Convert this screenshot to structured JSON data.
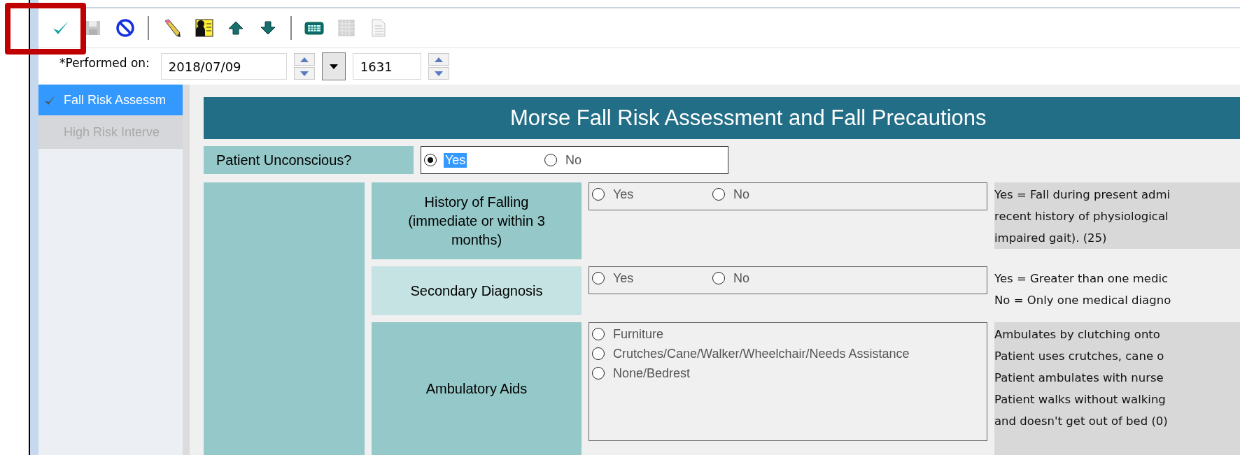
{
  "toolbar": [
    {
      "kind": "check",
      "disabled": false
    },
    {
      "kind": "save",
      "disabled": true
    },
    {
      "kind": "cancel",
      "disabled": false
    },
    {
      "kind": "separator"
    },
    {
      "kind": "pen",
      "disabled": false
    },
    {
      "kind": "card",
      "disabled": false
    },
    {
      "kind": "up",
      "disabled": false
    },
    {
      "kind": "down",
      "disabled": false
    },
    {
      "kind": "separator"
    },
    {
      "kind": "calculator",
      "disabled": false
    },
    {
      "kind": "grid",
      "disabled": true
    },
    {
      "kind": "document",
      "disabled": true
    }
  ],
  "performed": {
    "label": "*Performed on:",
    "date": "2018/07/09",
    "time": "1631"
  },
  "sidebar": {
    "items": [
      {
        "label": "Fall Risk Assessm",
        "selected": true,
        "checked": true
      },
      {
        "label": "High Risk Interve",
        "selected": false,
        "checked": false
      }
    ]
  },
  "form": {
    "title": "Morse Fall Risk Assessment and Fall Precautions",
    "unconscious": {
      "label": "Patient Unconscious?",
      "options": [
        {
          "label": "Yes",
          "selected": true
        },
        {
          "label": "No",
          "selected": false
        }
      ]
    },
    "rows": [
      {
        "label": "History of Falling (immediate or within 3 months)",
        "kind": "inline",
        "pale": false,
        "options": [
          {
            "label": "Yes",
            "selected": false
          },
          {
            "label": "No",
            "selected": false
          }
        ],
        "shaded": true,
        "description": [
          "Yes = Fall during present admi",
          "recent history of physiological",
          "impaired gait). (25)"
        ]
      },
      {
        "label": "Secondary Diagnosis",
        "kind": "inline",
        "pale": true,
        "options": [
          {
            "label": "Yes",
            "selected": false
          },
          {
            "label": "No",
            "selected": false
          }
        ],
        "shaded": false,
        "description": [
          "Yes = Greater than one medic",
          "No  = Only one medical diagno"
        ]
      },
      {
        "label": "Ambulatory Aids",
        "kind": "stacked",
        "pale": false,
        "options": [
          {
            "label": "Furniture",
            "selected": false
          },
          {
            "label": "Crutches/Cane/Walker/Wheelchair/Needs Assistance",
            "selected": false
          },
          {
            "label": "None/Bedrest",
            "selected": false
          }
        ],
        "shaded": true,
        "description": [
          "Ambulates by clutching onto",
          "Patient uses crutches, cane o",
          "Patient ambulates with nurse",
          "Patient walks without walking",
          "and doesn't get out of bed (0)"
        ]
      }
    ]
  }
}
